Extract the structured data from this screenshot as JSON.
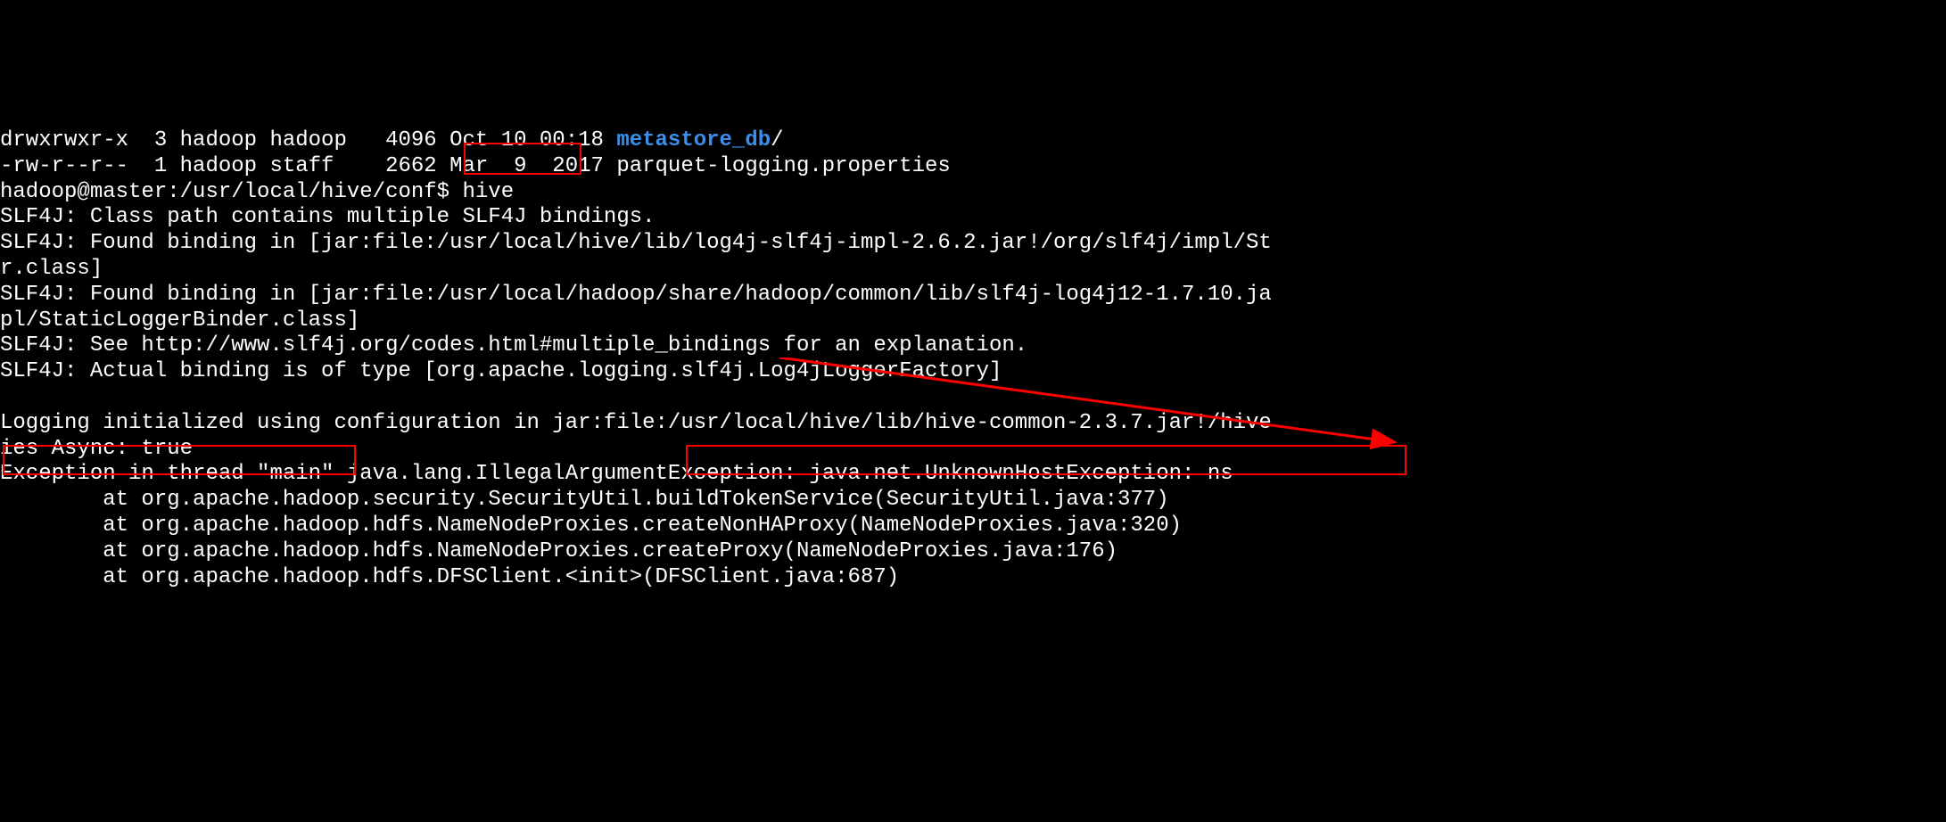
{
  "lines": {
    "l0_part1": "drwxrwxr-x  3 hadoop hadoop   4096 Oct 10 00:18 ",
    "l0_dir": "metastore_db",
    "l0_part2": "/",
    "l1": "-rw-r--r--  1 hadoop staff    2662 Mar  9  2017 parquet-logging.properties",
    "l2_prompt": "hadoop@master:/usr/local/hive/conf$ ",
    "l2_cmd": "hive",
    "l3": "SLF4J: Class path contains multiple SLF4J bindings.",
    "l4": "SLF4J: Found binding in [jar:file:/usr/local/hive/lib/log4j-slf4j-impl-2.6.2.jar!/org/slf4j/impl/St",
    "l5": "r.class]",
    "l6": "SLF4J: Found binding in [jar:file:/usr/local/hadoop/share/hadoop/common/lib/slf4j-log4j12-1.7.10.ja",
    "l7": "pl/StaticLoggerBinder.class]",
    "l8": "SLF4J: See http://www.slf4j.org/codes.html#multiple_bindings for an explanation.",
    "l9": "SLF4J: Actual binding is of type [org.apache.logging.slf4j.Log4jLoggerFactory]",
    "l10": "",
    "l11": "Logging initialized using configuration in jar:file:/usr/local/hive/lib/hive-common-2.3.7.jar!/hive",
    "l12": "ies Async: true",
    "l13": "Exception in thread \"main\" java.lang.IllegalArgumentException: java.net.UnknownHostException: ns",
    "l14": "        at org.apache.hadoop.security.SecurityUtil.buildTokenService(SecurityUtil.java:377)",
    "l15": "        at org.apache.hadoop.hdfs.NameNodeProxies.createNonHAProxy(NameNodeProxies.java:320)",
    "l16": "        at org.apache.hadoop.hdfs.NameNodeProxies.createProxy(NameNodeProxies.java:176)",
    "l17": "        at org.apache.hadoop.hdfs.DFSClient.<init>(DFSClient.java:687)"
  }
}
